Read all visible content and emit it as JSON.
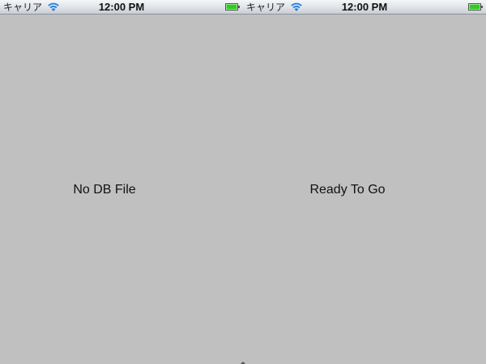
{
  "left": {
    "status": {
      "carrier": "キャリア",
      "time": "12:00 PM"
    },
    "label": "No DB File"
  },
  "right": {
    "status": {
      "carrier": "キャリア",
      "time": "12:00 PM"
    },
    "label": "Ready To Go"
  },
  "colors": {
    "background": "#c0c0c0",
    "wifi": "#2a7fe0",
    "battery": "#2ecc1f"
  }
}
